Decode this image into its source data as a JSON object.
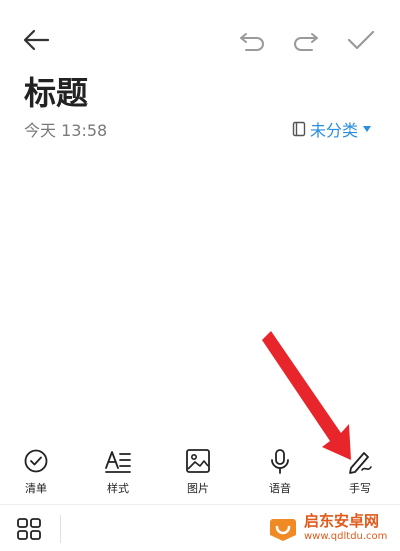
{
  "note": {
    "title": "标题",
    "timestamp": "今天 13:58",
    "category": "未分类"
  },
  "toolbar": {
    "items": [
      {
        "label": "清单",
        "icon": "checklist-icon"
      },
      {
        "label": "样式",
        "icon": "text-style-icon"
      },
      {
        "label": "图片",
        "icon": "image-icon"
      },
      {
        "label": "语音",
        "icon": "microphone-icon"
      },
      {
        "label": "手写",
        "icon": "handwriting-pen-icon"
      }
    ]
  },
  "watermark": {
    "title": "启东安卓网",
    "url": "www.qdltdu.com"
  },
  "colors": {
    "accent": "#2a8fe0",
    "arrow": "#e8252a",
    "watermark": "#e05a1c"
  }
}
